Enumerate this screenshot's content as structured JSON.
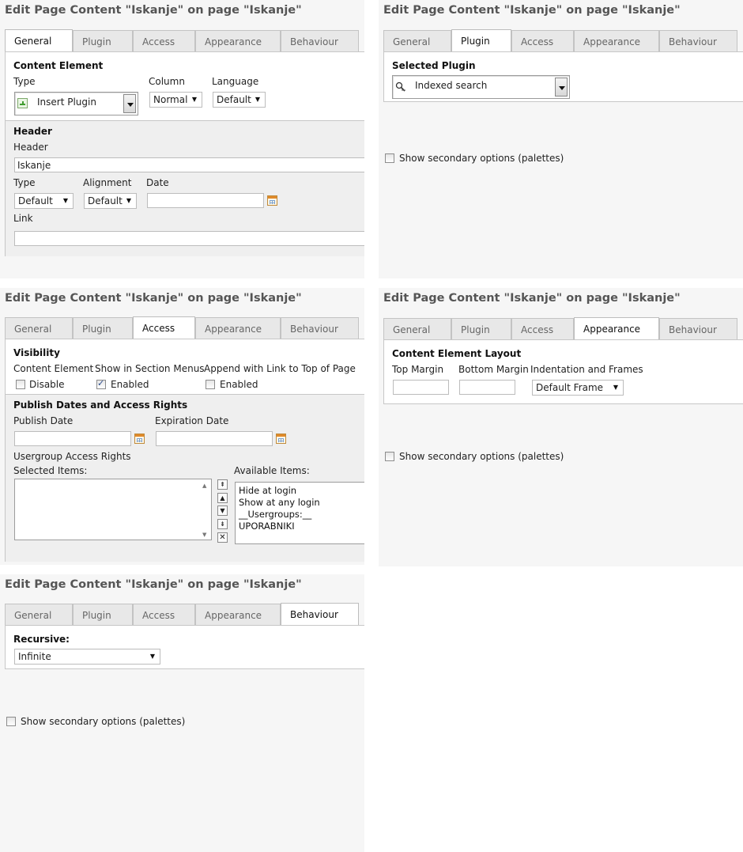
{
  "title": "Edit Page Content \"Iskanje\" on page \"Iskanje\"",
  "tabs": [
    "General",
    "Plugin",
    "Access",
    "Appearance",
    "Behaviour"
  ],
  "general": {
    "content_element": "Content Element",
    "type_label": "Type",
    "type_value": "Insert Plugin",
    "column_label": "Column",
    "column_value": "Normal",
    "language_label": "Language",
    "language_value": "Default",
    "header_section": "Header",
    "header_label": "Header",
    "header_value": "Iskanje",
    "htype_label": "Type",
    "htype_value": "Default",
    "align_label": "Alignment",
    "align_value": "Default",
    "date_label": "Date",
    "date_value": "",
    "link_label": "Link",
    "link_value": ""
  },
  "plugin": {
    "selected_label": "Selected Plugin",
    "selected_value": "Indexed search",
    "secondary_label": "Show secondary options (palettes)"
  },
  "access": {
    "visibility": "Visibility",
    "content_element": "Content Element",
    "disable_label": "Disable",
    "disable_checked": false,
    "section_menus": "Show in Section Menus",
    "section_enabled": "Enabled",
    "section_checked": true,
    "append_top": "Append with Link to Top of Page",
    "append_enabled": "Enabled",
    "append_checked": false,
    "dates_section": "Publish Dates and Access Rights",
    "publish_label": "Publish Date",
    "publish_value": "",
    "expiration_label": "Expiration Date",
    "expiration_value": "",
    "usergroup_label": "Usergroup Access Rights",
    "selected_items_label": "Selected Items:",
    "available_items_label": "Available Items:",
    "available_items": [
      "Hide at login",
      "Show at any login",
      "__Usergroups:__",
      "UPORABNIKI"
    ]
  },
  "appearance": {
    "layout": "Content Element Layout",
    "top_margin_label": "Top Margin",
    "top_margin_value": "",
    "bottom_margin_label": "Bottom Margin",
    "bottom_margin_value": "",
    "frames_label": "Indentation and Frames",
    "frames_value": "Default Frame",
    "secondary_label": "Show secondary options (palettes)"
  },
  "behaviour": {
    "recursive_label": "Recursive:",
    "recursive_value": "Infinite",
    "secondary_label": "Show secondary options (palettes)"
  }
}
